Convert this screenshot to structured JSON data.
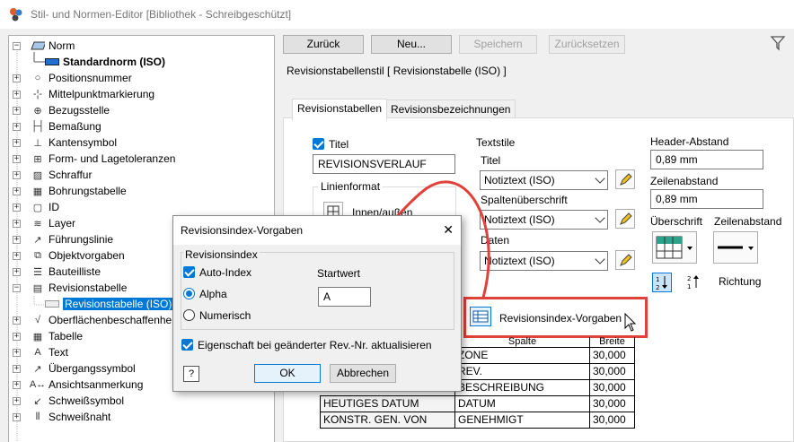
{
  "window": {
    "title": "Stil- und Normen-Editor [Bibliothek - Schreibgeschützt]"
  },
  "tree": {
    "norm": "Norm",
    "standardnorm": "Standardnorm (ISO)",
    "items": [
      "Positionsnummer",
      "Mittelpunktmarkierung",
      "Bezugsstelle",
      "Bemaßung",
      "Kantensymbol",
      "Form- und Lagetoleranzen",
      "Schraffur",
      "Bohrungstabelle",
      "ID",
      "Layer",
      "Führungslinie",
      "Objektvorgaben",
      "Bauteilliste",
      "Revisionstabelle"
    ],
    "selected_child": "Revisionstabelle (ISO)",
    "items_after": [
      "Oberflächenbeschaffenheit",
      "Tabelle",
      "Text",
      "Übergangssymbol",
      "Ansichtsanmerkung",
      "Schweißsymbol",
      "Schweißnaht"
    ]
  },
  "toolbar": {
    "back": "Zurück",
    "new": "Neu...",
    "save": "Speichern",
    "reset": "Zurücksetzen"
  },
  "style_header": "Revisionstabellenstil [ Revisionstabelle (ISO) ]",
  "tabs": [
    "Revisionstabellen",
    "Revisionsbezeichnungen"
  ],
  "title_section": {
    "checkbox_label": "Titel",
    "value": "REVISIONSVERLAUF"
  },
  "line_format": {
    "label": "Linienformat",
    "button": "Innen/außen"
  },
  "text_styles": {
    "label": "Textstile",
    "title_label": "Titel",
    "title_value": "Notiztext (ISO)",
    "column_label": "Spaltenüberschrift",
    "column_value": "Notiztext (ISO)",
    "data_label": "Daten",
    "data_value": "Notiztext (ISO)"
  },
  "header_spacing": {
    "label": "Header-Abstand",
    "value": "0,89 mm"
  },
  "row_spacing": {
    "label": "Zeilenabstand",
    "value": "0,89 mm"
  },
  "heading_label": "Überschrift",
  "row_spacing_label2": "Zeilenabstand",
  "direction_label": "Richtung",
  "rev_index_button": "Revisionsindex-Vorgaben",
  "table": {
    "headers": [
      "Spalte",
      "Breite"
    ],
    "rows": [
      [
        "",
        "ZONE",
        "30,000"
      ],
      [
        "",
        "REV.",
        "30,000"
      ],
      [
        "",
        "BESCHREIBUNG",
        "30,000"
      ],
      [
        "HEUTIGES DATUM",
        "DATUM",
        "30,000"
      ],
      [
        "KONSTR. GEN. VON",
        "GENEHMIGT",
        "30,000"
      ]
    ]
  },
  "dialog": {
    "title": "Revisionsindex-Vorgaben",
    "group": "Revisionsindex",
    "auto_index": "Auto-Index",
    "alpha": "Alpha",
    "numeric": "Numerisch",
    "start_label": "Startwert",
    "start_value": "A",
    "update_label": "Eigenschaft bei geänderter Rev.-Nr. aktualisieren",
    "ok": "OK",
    "cancel": "Abbrechen",
    "close_glyph": "✕",
    "help_glyph": "?"
  },
  "colors": {
    "accent": "#0078d7",
    "highlight": "#e0413a"
  }
}
